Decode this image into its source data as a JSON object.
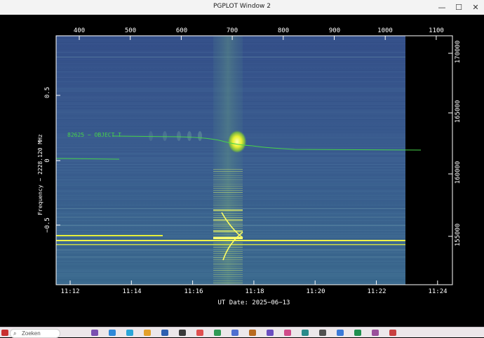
{
  "window": {
    "title": "PGPLOT Window 2",
    "controls": [
      "—",
      "☐",
      "✕"
    ]
  },
  "plot": {
    "top_axis_ticks": [
      "400",
      "500",
      "600",
      "700",
      "800",
      "900",
      "1000",
      "1100"
    ],
    "left_axis_ticks": [
      "0.5",
      "0",
      "−0.5"
    ],
    "right_axis_ticks": [
      "170000",
      "165000",
      "160000",
      "155000"
    ],
    "bottom_axis_ticks": [
      "11:12",
      "11:14",
      "11:16",
      "11:18",
      "11:20",
      "11:22",
      "11:24"
    ],
    "ylabel": "Frequency − 2228.120 MHz",
    "xlabel": "UT Date: 2025−06−13",
    "annotation": "82625 − OBJECT T",
    "colors": {
      "background": "#3a5a8c",
      "trace": "#47d34a",
      "hot": "#ffff40",
      "axis": "#ffffff"
    }
  },
  "taskbar": {
    "search_placeholder": "Zoeken",
    "app_icons": [
      "app-1",
      "app-2",
      "app-3",
      "app-4",
      "app-5",
      "app-6",
      "app-7",
      "app-8",
      "app-9",
      "app-10",
      "app-11",
      "app-12",
      "app-13",
      "app-14",
      "app-15",
      "app-16",
      "app-17",
      "app-18"
    ]
  }
}
